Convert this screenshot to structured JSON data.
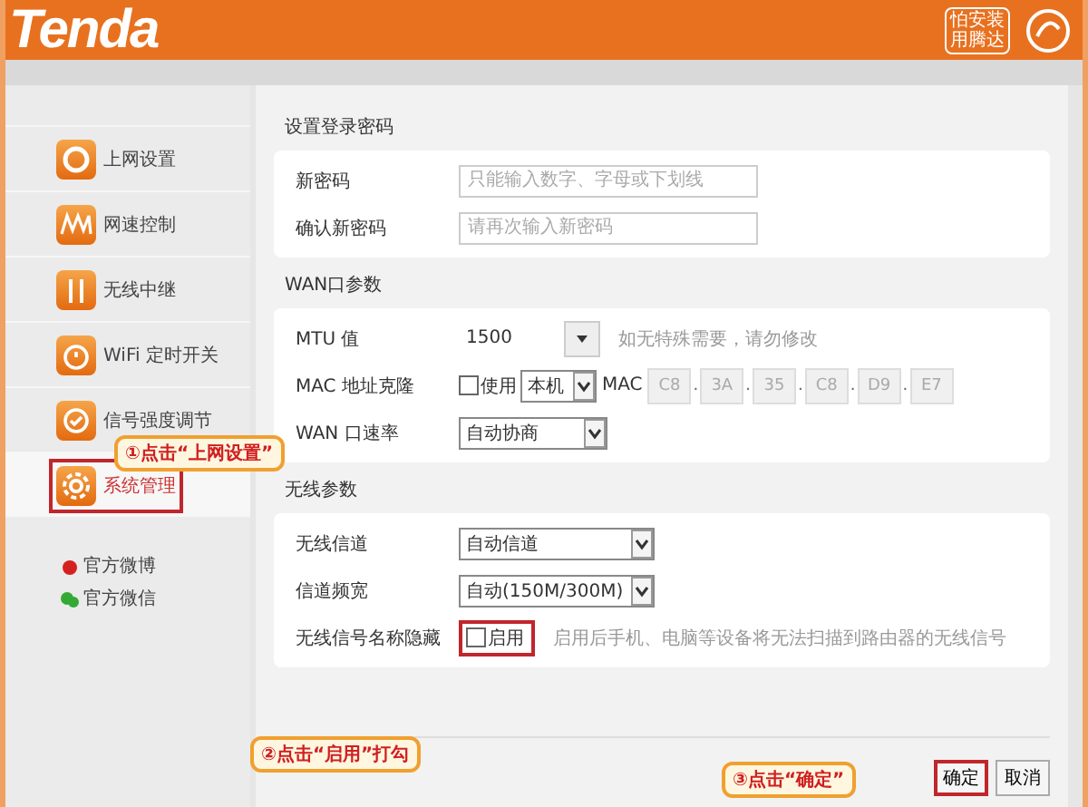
{
  "header": {
    "logo": "Tenda",
    "badge": [
      "怕安装",
      "用腾达"
    ]
  },
  "sidebar": {
    "items": [
      {
        "label": "上网设置",
        "kind": "ie",
        "selected": false
      },
      {
        "label": "网速控制",
        "kind": "speed",
        "selected": false
      },
      {
        "label": "无线中继",
        "kind": "relay",
        "selected": false
      },
      {
        "label": "WiFi 定时开关",
        "kind": "timer",
        "selected": false
      },
      {
        "label": "信号强度调节",
        "kind": "signal",
        "selected": false
      },
      {
        "label": "系统管理",
        "kind": "gear",
        "selected": true
      }
    ],
    "links": [
      {
        "label": "官方微博",
        "kind": "weibo"
      },
      {
        "label": "官方微信",
        "kind": "wechat"
      }
    ]
  },
  "sections": [
    {
      "title": "设置登录密码",
      "rows": [
        {
          "kind": "input",
          "label": "新密码",
          "placeholder": "只能输入数字、字母或下划线"
        },
        {
          "kind": "input",
          "label": "确认新密码",
          "placeholder": "请再次输入新密码"
        }
      ]
    },
    {
      "title": "WAN口参数",
      "rows": [
        {
          "kind": "combo",
          "label": "MTU 值",
          "value": "1500",
          "hint": "如无特殊需要，请勿修改"
        },
        {
          "kind": "mac",
          "label": "MAC 地址克隆",
          "check_label": "使用",
          "checked": false,
          "select": "本机",
          "mac_label": "MAC",
          "mac_separator": ".",
          "mac": [
            "C8",
            "3A",
            "35",
            "C8",
            "D9",
            "E7"
          ]
        },
        {
          "kind": "select",
          "label": "WAN 口速率",
          "value": "自动协商"
        }
      ]
    },
    {
      "title": "无线参数",
      "rows": [
        {
          "kind": "select",
          "label": "无线信道",
          "value": "自动信道"
        },
        {
          "kind": "select",
          "label": "信道频宽",
          "value": "自动(150M/300M)"
        },
        {
          "kind": "check",
          "label": "无线信号名称隐藏",
          "check_label": "启用",
          "checked": false,
          "hint": "启用后手机、电脑等设备将无法扫描到路由器的无线信号"
        }
      ]
    }
  ],
  "buttons": [
    "确定",
    "取消"
  ],
  "callouts": [
    "①点击“上网设置”",
    "②点击“启用”打勾",
    "③点击“确定”"
  ]
}
